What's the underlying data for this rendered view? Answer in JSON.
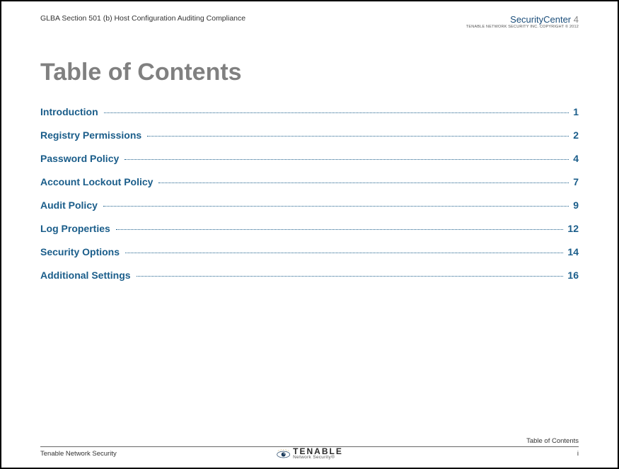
{
  "header": {
    "docTitle": "GLBA Section 501 (b) Host Configuration Auditing Compliance",
    "brand": "SecurityCenter",
    "brandVersion": "4",
    "brandSub": "TENABLE NETWORK SECURITY INC. COPYRIGHT © 2012"
  },
  "title": "Table of Contents",
  "toc": {
    "items": [
      {
        "label": "Introduction",
        "page": "1"
      },
      {
        "label": "Registry Permissions",
        "page": "2"
      },
      {
        "label": "Password Policy",
        "page": "4"
      },
      {
        "label": "Account Lockout Policy",
        "page": "7"
      },
      {
        "label": "Audit Policy",
        "page": "9"
      },
      {
        "label": "Log Properties",
        "page": "12"
      },
      {
        "label": "Security Options",
        "page": "14"
      },
      {
        "label": "Additional Settings",
        "page": "16"
      }
    ]
  },
  "footer": {
    "section": "Table of Contents",
    "company": "Tenable Network Security",
    "logoName": "TENABLE",
    "logoSub": "Network Security®",
    "pageNum": "i"
  }
}
